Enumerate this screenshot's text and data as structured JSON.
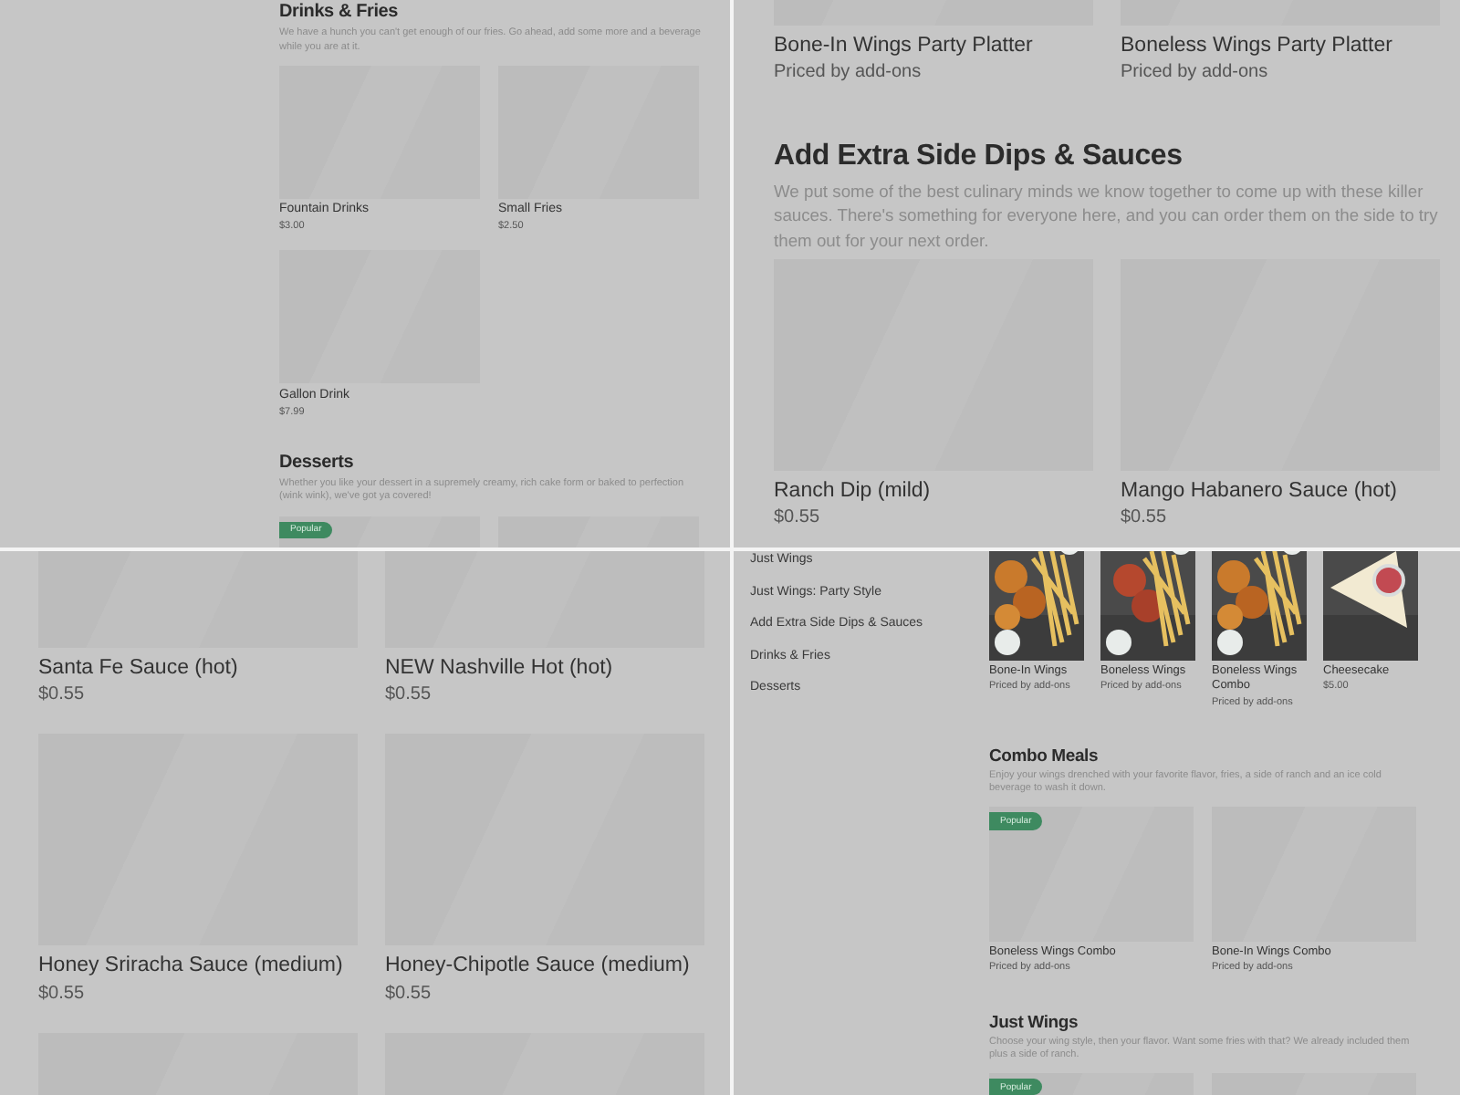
{
  "panels": [
    {
      "kind": "compact",
      "blocks": [
        {
          "kind": "section",
          "title": "Drinks & Fries",
          "description": "We have a hunch you can't get enough of our fries. Go ahead, add some more and a beverage while you are at it."
        },
        {
          "kind": "cards",
          "cards": [
            {
              "kind": "item",
              "name": "Fountain Drinks",
              "price": "$3.00"
            },
            {
              "kind": "item",
              "name": "Small Fries",
              "price": "$2.50"
            },
            {
              "kind": "item",
              "name": "Gallon Drink",
              "price": "$7.99"
            }
          ]
        },
        {
          "kind": "section",
          "title": "Desserts",
          "description": "Whether you like your dessert in a supremely creamy, rich cake form or baked to perfection (wink wink), we've got ya covered!"
        },
        {
          "kind": "cards",
          "cards": [
            {
              "kind": "placeholder",
              "badge": "Popular"
            },
            {
              "kind": "placeholder"
            }
          ]
        }
      ]
    },
    {
      "kind": "wide",
      "blocks": [
        {
          "kind": "cards",
          "cards": [
            {
              "kind": "item",
              "name": "Bone-In Wings Party Platter",
              "price": "Priced by add-ons"
            },
            {
              "kind": "item",
              "name": "Boneless Wings Party Platter",
              "price": "Priced by add-ons"
            }
          ]
        },
        {
          "kind": "section",
          "title": "Add Extra Side Dips & Sauces",
          "description": "We put some of the best culinary minds we know together to come up with these killer sauces. There's something for everyone here, and you can order them on the side to try them out for your next order."
        },
        {
          "kind": "cards",
          "cards": [
            {
              "kind": "item",
              "name": "Ranch Dip (mild)",
              "price": "$0.55"
            },
            {
              "kind": "item",
              "name": "Mango Habanero Sauce (hot)",
              "price": "$0.55"
            }
          ]
        }
      ]
    },
    {
      "kind": "wide",
      "blocks": [
        {
          "kind": "cards",
          "cards": [
            {
              "kind": "item",
              "name": "Santa Fe Sauce (hot)",
              "price": "$0.55"
            },
            {
              "kind": "item",
              "name": "NEW Nashville Hot (hot)",
              "price": "$0.55"
            },
            {
              "kind": "item",
              "name": "Honey Sriracha Sauce (medium)",
              "price": "$0.55"
            },
            {
              "kind": "item",
              "name": "Honey-Chipotle Sauce (medium)",
              "price": "$0.55"
            },
            {
              "kind": "placeholder"
            },
            {
              "kind": "placeholder"
            }
          ]
        }
      ]
    },
    {
      "kind": "sidebar",
      "sidebar": {
        "items": [
          {
            "label": "Just Wings"
          },
          {
            "label": "Just Wings: Party Style"
          },
          {
            "label": "Add Extra Side Dips & Sauces"
          },
          {
            "label": "Drinks & Fries"
          },
          {
            "label": "Desserts"
          }
        ]
      },
      "blocks": [
        {
          "kind": "photos",
          "cards": [
            {
              "name": "Bone-In Wings",
              "price": "Priced by add-ons"
            },
            {
              "name": "Boneless Wings",
              "price": "Priced by add-ons"
            },
            {
              "name": "Boneless Wings Combo",
              "price": "Priced by add-ons"
            },
            {
              "name": "Cheesecake",
              "price": "$5.00"
            }
          ]
        },
        {
          "kind": "section",
          "title": "Combo Meals",
          "description": "Enjoy your wings drenched with your favorite flavor, fries, a side of ranch and an ice cold beverage to wash it down."
        },
        {
          "kind": "cards",
          "cards": [
            {
              "kind": "item",
              "badge": "Popular",
              "name": "Boneless Wings Combo",
              "price": "Priced by add-ons"
            },
            {
              "kind": "item",
              "name": "Bone-In Wings Combo",
              "price": "Priced by add-ons"
            }
          ]
        },
        {
          "kind": "section",
          "title": "Just Wings",
          "description": "Choose your wing style, then your flavor. Want some fries with that? We already included them plus a side of ranch."
        },
        {
          "kind": "cards",
          "cards": [
            {
              "kind": "placeholder",
              "badge": "Popular"
            },
            {
              "kind": "placeholder"
            }
          ]
        }
      ]
    }
  ]
}
